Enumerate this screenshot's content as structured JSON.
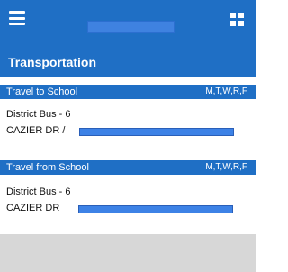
{
  "header": {
    "title": "Transportation"
  },
  "sections": [
    {
      "title": "Travel to School",
      "days": "M,T,W,R,F",
      "bus": "District Bus - 6",
      "stop": "CAZIER DR /"
    },
    {
      "title": "Travel from School",
      "days": "M,T,W,R,F",
      "bus": "District Bus - 6",
      "stop": "CAZIER DR"
    }
  ],
  "colors": {
    "header_blue": "#1f6fc5",
    "redaction_blue": "#3d82e6",
    "footer_gray": "#d7d7d7"
  },
  "icons": {
    "menu": "hamburger-menu-icon",
    "apps": "grid-apps-icon"
  }
}
